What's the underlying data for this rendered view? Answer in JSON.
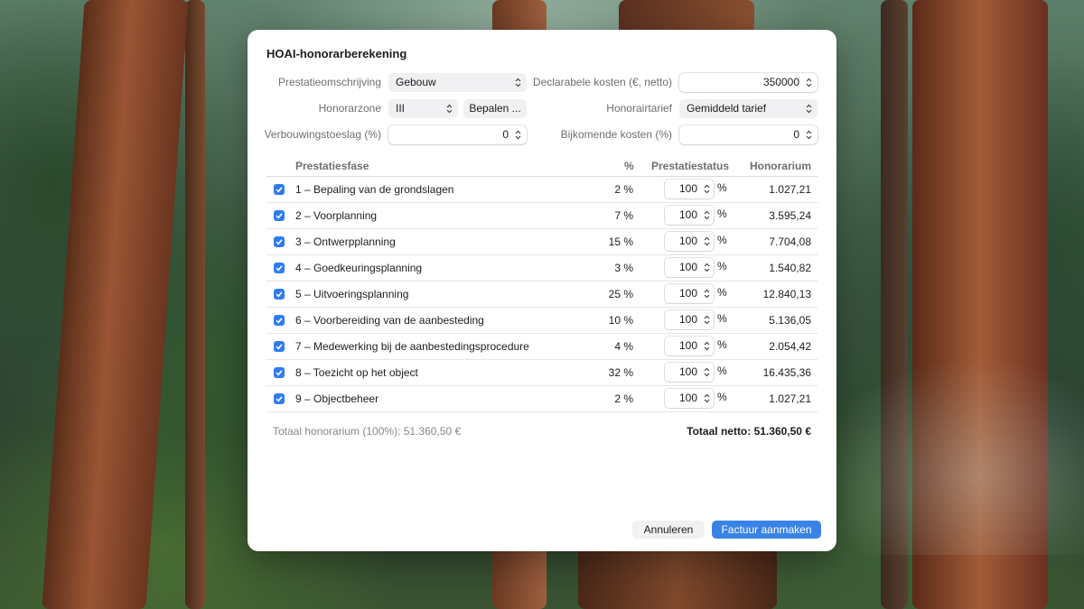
{
  "dialog": {
    "title": "HOAI-honorarberekening",
    "form": {
      "service_label": "Prestatieomschrijving",
      "service_value": "Gebouw",
      "costs_label": "Declarabele kosten (€, netto)",
      "costs_value": "350000",
      "zone_label": "Honorarzone",
      "zone_value": "III",
      "determine_label": "Bepalen ...",
      "rate_label": "Honorairtarief",
      "rate_value": "Gemiddeld tarief",
      "surcharge_label": "Verbouwingstoeslag (%)",
      "surcharge_value": "0",
      "extra_costs_label": "Bijkomende kosten (%)",
      "extra_costs_value": "0"
    },
    "table": {
      "headers": {
        "phase": "Prestatiesfase",
        "percent": "%",
        "status": "Prestatiestatus",
        "fee": "Honorarium"
      },
      "rows": [
        {
          "phase": "1 – Bepaling van de grondslagen",
          "percent": "2 %",
          "status": "100",
          "unit": "%",
          "fee": "1.027,21",
          "checked": true
        },
        {
          "phase": "2 – Voorplanning",
          "percent": "7 %",
          "status": "100",
          "unit": "%",
          "fee": "3.595,24",
          "checked": true
        },
        {
          "phase": "3 – Ontwerpplanning",
          "percent": "15 %",
          "status": "100",
          "unit": "%",
          "fee": "7.704,08",
          "checked": true
        },
        {
          "phase": "4 – Goedkeuringsplanning",
          "percent": "3 %",
          "status": "100",
          "unit": "%",
          "fee": "1.540,82",
          "checked": true
        },
        {
          "phase": "5 – Uitvoeringsplanning",
          "percent": "25 %",
          "status": "100",
          "unit": "%",
          "fee": "12.840,13",
          "checked": true
        },
        {
          "phase": "6 – Voorbereiding van de aanbesteding",
          "percent": "10 %",
          "status": "100",
          "unit": "%",
          "fee": "5.136,05",
          "checked": true
        },
        {
          "phase": "7 – Medewerking bij de aanbestedingsprocedure",
          "percent": "4 %",
          "status": "100",
          "unit": "%",
          "fee": "2.054,42",
          "checked": true
        },
        {
          "phase": "8 – Toezicht op het object",
          "percent": "32 %",
          "status": "100",
          "unit": "%",
          "fee": "16.435,36",
          "checked": true
        },
        {
          "phase": "9 – Objectbeheer",
          "percent": "2 %",
          "status": "100",
          "unit": "%",
          "fee": "1.027,21",
          "checked": true
        }
      ]
    },
    "totals": {
      "total_fee": "Totaal honorarium (100%): 51.360,50 €",
      "total_net": "Totaal netto: 51.360,50 €"
    },
    "buttons": {
      "cancel": "Annuleren",
      "create_invoice": "Factuur aanmaken"
    }
  },
  "colors": {
    "accent": "#3a83e6",
    "checkbox": "#2f7bf5"
  }
}
